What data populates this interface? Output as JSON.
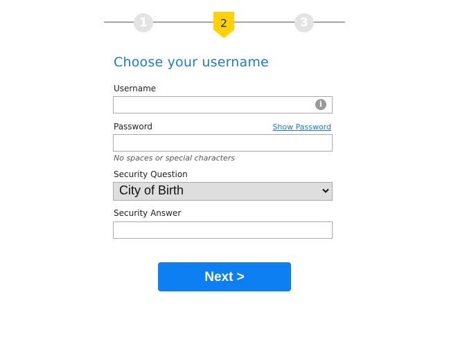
{
  "stepper": {
    "steps": [
      {
        "number": "1",
        "state": "inactive"
      },
      {
        "number": "2",
        "state": "active"
      },
      {
        "number": "3",
        "state": "inactive"
      }
    ],
    "current_step": 2,
    "active_color": "#ffd200",
    "inactive_color": "#e3e3e3"
  },
  "form": {
    "title": "Choose your username",
    "username": {
      "label": "Username",
      "value": "",
      "info_icon": "info-icon"
    },
    "password": {
      "label": "Password",
      "value": "",
      "show_password_link": "Show Password",
      "hint": "No spaces or special characters"
    },
    "security_question": {
      "label": "Security Question",
      "selected": "City of Birth"
    },
    "security_answer": {
      "label": "Security Answer",
      "value": ""
    }
  },
  "actions": {
    "next_label": "Next >"
  },
  "colors": {
    "title": "#1a7bd6",
    "link": "#1a7bd6",
    "button": "#0d7ff2",
    "select_bg": "#dedede"
  }
}
